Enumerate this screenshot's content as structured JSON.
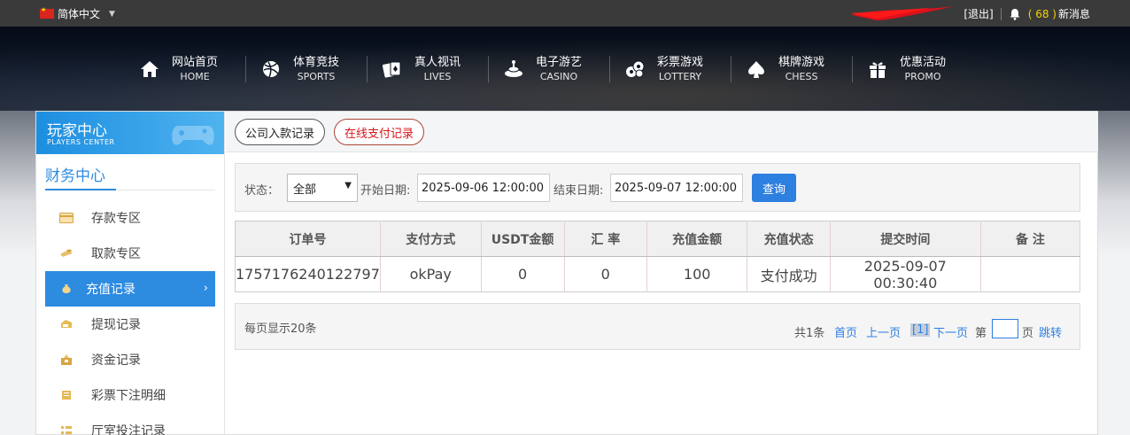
{
  "topbar": {
    "language": "简体中文",
    "logout": "[退出]",
    "message_count": "( 68 )",
    "message_label": "新消息"
  },
  "nav": [
    {
      "cn": "网站首页",
      "en": "HOME",
      "icon": "home-icon"
    },
    {
      "cn": "体育竞技",
      "en": "SPORTS",
      "icon": "ball-icon"
    },
    {
      "cn": "真人视讯",
      "en": "LIVES",
      "icon": "cards-icon"
    },
    {
      "cn": "电子游艺",
      "en": "CASINO",
      "icon": "slot-icon"
    },
    {
      "cn": "彩票游戏",
      "en": "LOTTERY",
      "icon": "lottery-icon"
    },
    {
      "cn": "棋牌游戏",
      "en": "CHESS",
      "icon": "spade-icon"
    },
    {
      "cn": "优惠活动",
      "en": "PROMO",
      "icon": "gift-icon"
    }
  ],
  "sidebar": {
    "title_cn": "玩家中心",
    "title_en": "PLAYERS CENTER",
    "section": "财务中心",
    "items": [
      {
        "label": "存款专区",
        "icon": "deposit-icon"
      },
      {
        "label": "取款专区",
        "icon": "withdraw-icon"
      },
      {
        "label": "充值记录",
        "icon": "recharge-icon",
        "active": true
      },
      {
        "label": "提现记录",
        "icon": "cashout-icon"
      },
      {
        "label": "资金记录",
        "icon": "funds-icon"
      },
      {
        "label": "彩票下注明细",
        "icon": "lottery-bet-icon"
      },
      {
        "label": "厅室投注记录",
        "icon": "hall-bet-icon"
      }
    ]
  },
  "tabs": [
    "公司入款记录",
    "在线支付记录"
  ],
  "filter": {
    "status_label": "状态：",
    "status_value": "全部",
    "start_label": "开始日期:",
    "start_value": "2025-09-06 12:00:00",
    "end_label": "结束日期:",
    "end_value": "2025-09-07 12:00:00",
    "query_button": "查询"
  },
  "table": {
    "headers": [
      "订单号",
      "支付方式",
      "USDT金额",
      "汇 率",
      "充值金额",
      "充值状态",
      "提交时间",
      "备 注"
    ],
    "rows": [
      [
        "1757176240122797",
        "okPay",
        "0",
        "0",
        "100",
        "支付成功",
        "2025-09-07 00:30:40",
        ""
      ]
    ]
  },
  "pager": {
    "per_page": "每页显示20条",
    "total": "共1条",
    "first": "首页",
    "prev": "上一页",
    "current": "[1]",
    "next": "下一页",
    "goto_prefix": "第",
    "goto_suffix": "页",
    "jump": "跳转"
  },
  "colors": {
    "accent": "#2d8be0",
    "active_tab_text": "#d9141a",
    "message_count": "#f5d300"
  }
}
